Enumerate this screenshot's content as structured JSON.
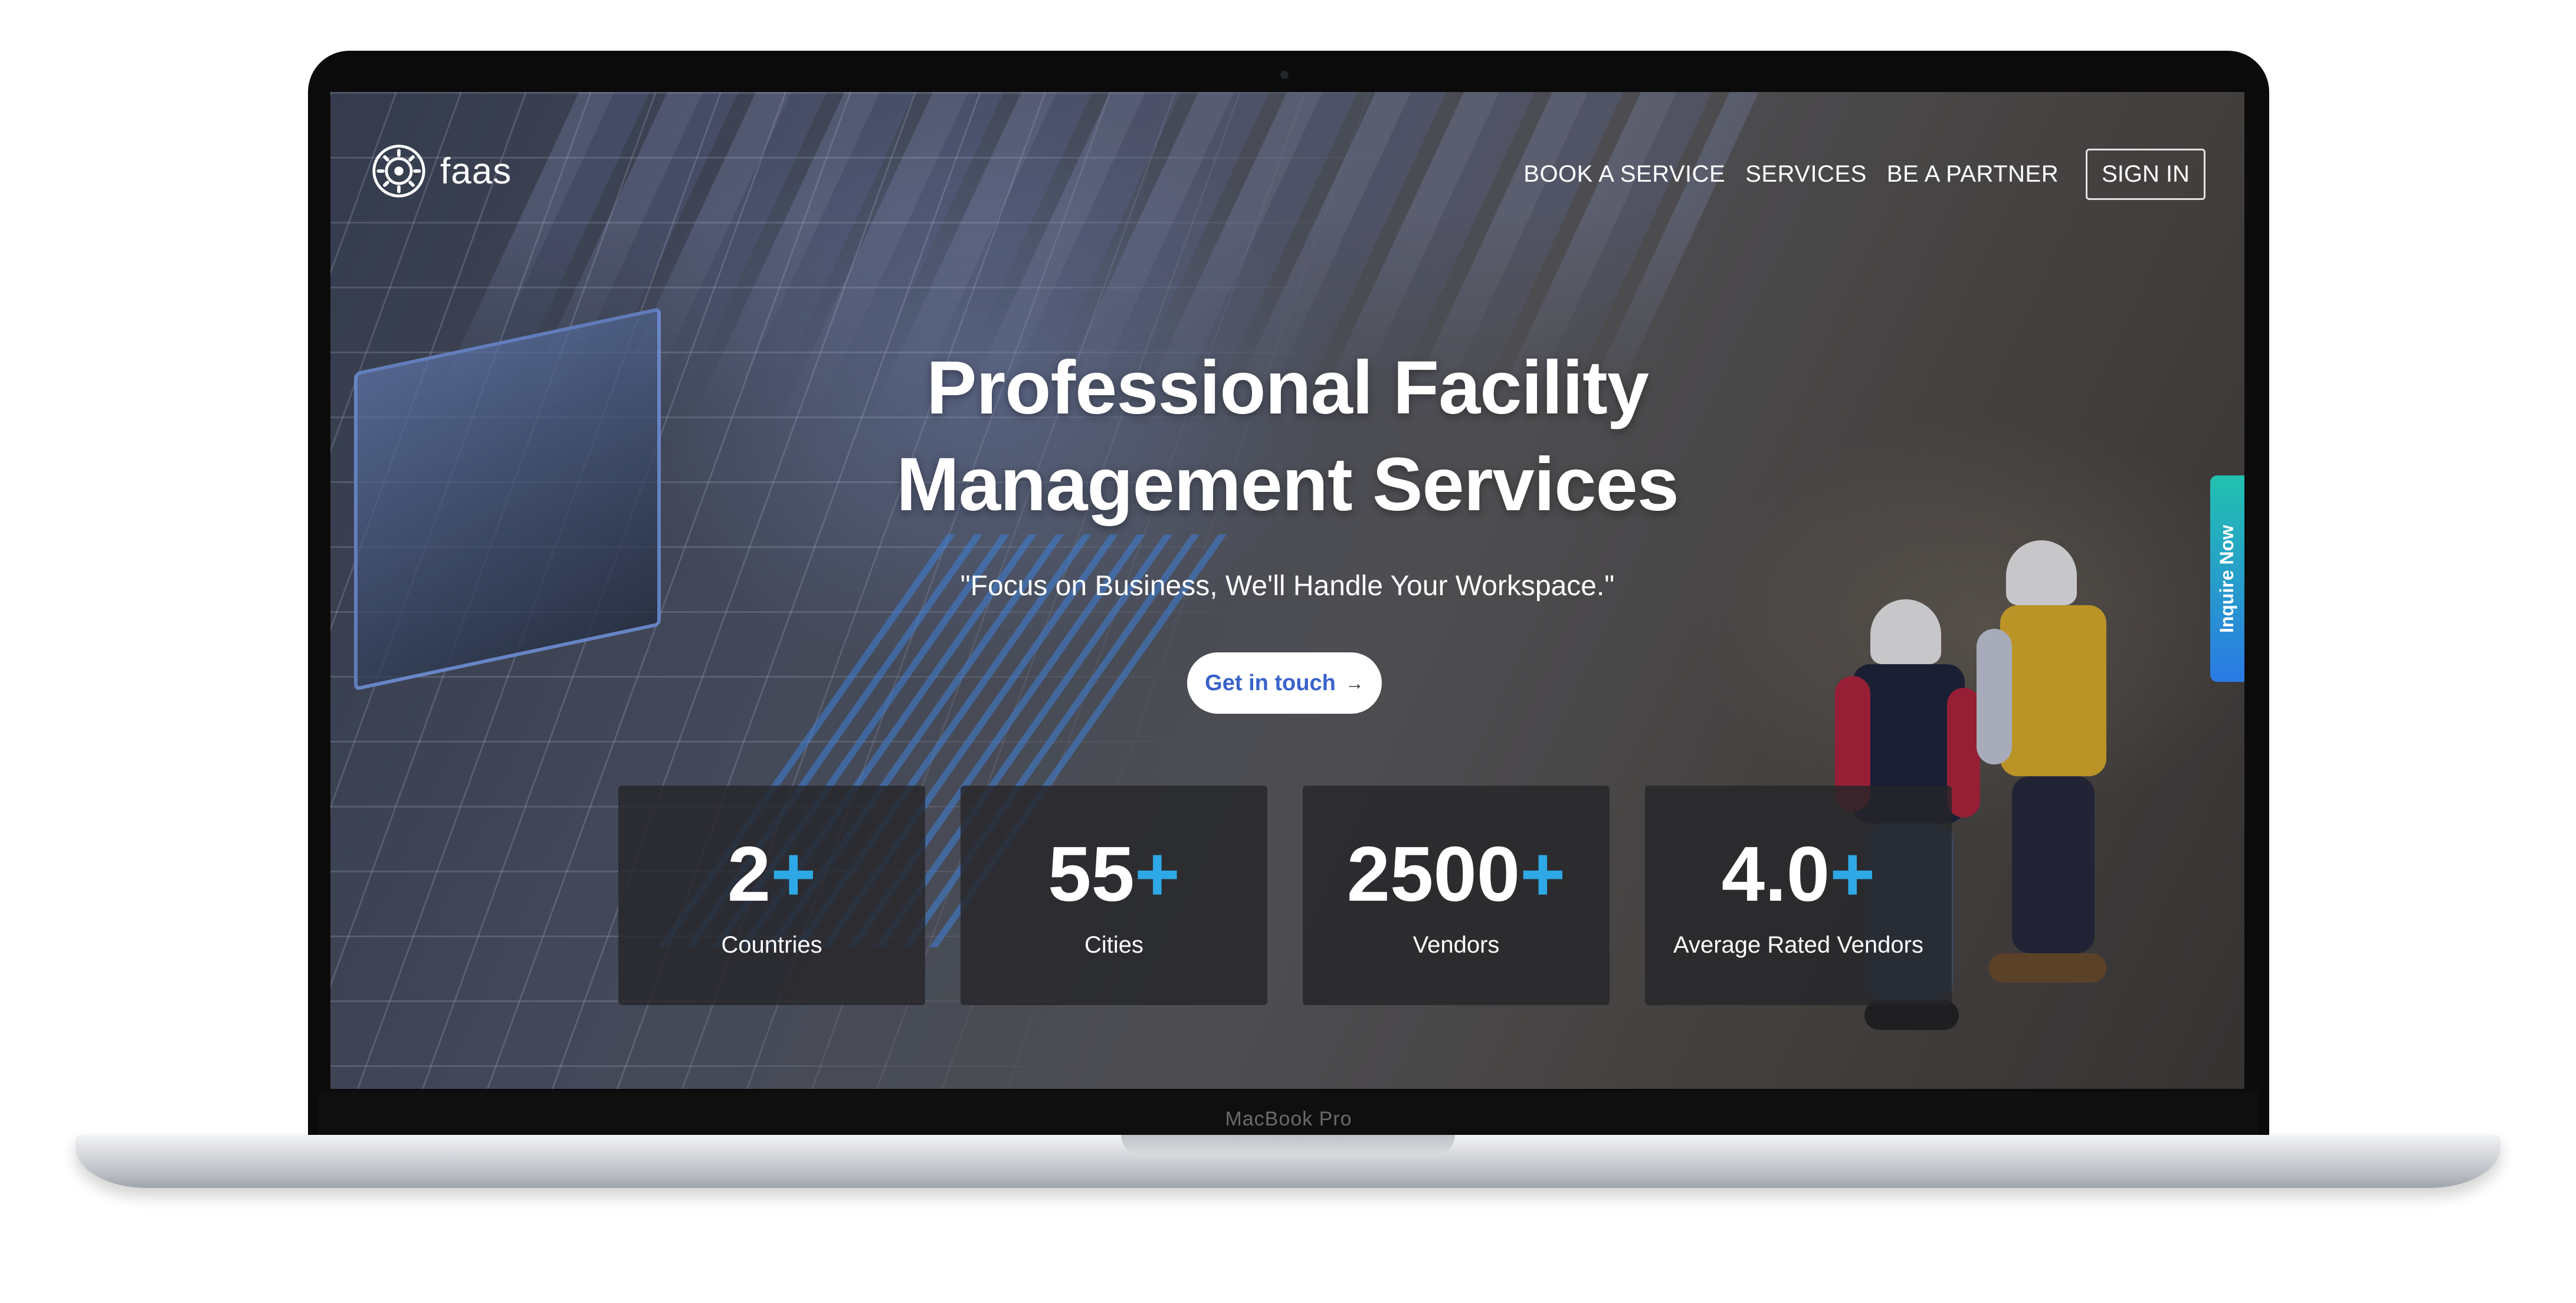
{
  "device": {
    "model_label": "MacBook Pro"
  },
  "brand": {
    "logo_text": "faas",
    "accent_color": "#2ea8e6"
  },
  "nav": {
    "links": [
      "BOOK A SERVICE",
      "SERVICES",
      "BE A PARTNER"
    ],
    "sign_in_label": "SIGN IN"
  },
  "hero": {
    "title_line1": "Professional Facility",
    "title_line2": "Management Services",
    "tagline": "\"Focus on Business, We'll Handle Your Workspace.\"",
    "cta_label": "Get in touch",
    "cta_icon": "arrow-right-icon"
  },
  "stats": [
    {
      "value": "2",
      "suffix": "+",
      "label": "Countries"
    },
    {
      "value": "55",
      "suffix": "+",
      "label": "Cities"
    },
    {
      "value": "2500",
      "suffix": "+",
      "label": "Vendors"
    },
    {
      "value": "4.0",
      "suffix": "+",
      "label": "Average Rated Vendors"
    }
  ],
  "side_tab": {
    "label": "Inquire Now"
  }
}
